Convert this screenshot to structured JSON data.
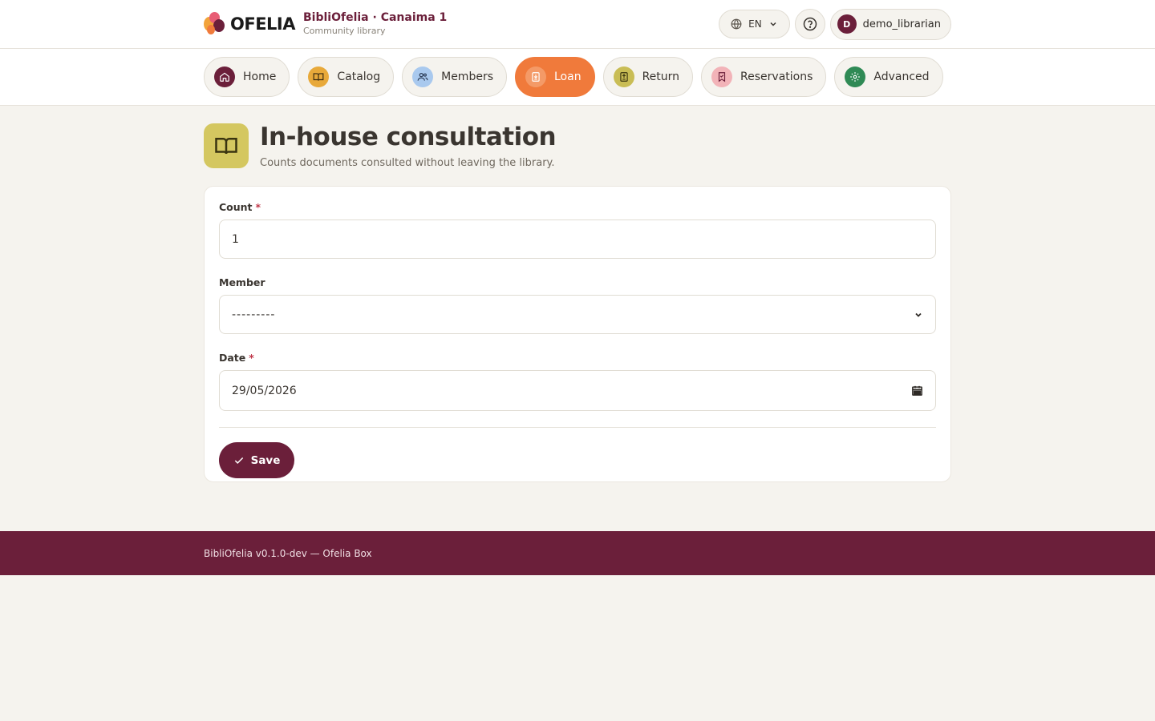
{
  "header": {
    "logo_word": "OFELIA",
    "brand_title": "BibliOfelia · Canaima 1",
    "brand_subtitle": "Community library",
    "language": "EN",
    "user_initial": "D",
    "username": "demo_librarian"
  },
  "nav": {
    "items": [
      {
        "label": "Home",
        "icon": "home-icon",
        "color": "#6b1f3a"
      },
      {
        "label": "Catalog",
        "icon": "book-icon",
        "color": "#e8a93a"
      },
      {
        "label": "Members",
        "icon": "users-icon",
        "color": "#a9c9ee"
      },
      {
        "label": "Loan",
        "icon": "loan-icon",
        "color": "#f07a3b",
        "active": true
      },
      {
        "label": "Return",
        "icon": "return-icon",
        "color": "#c9bd55"
      },
      {
        "label": "Reservations",
        "icon": "bookmark-icon",
        "color": "#f2b3b8"
      },
      {
        "label": "Advanced",
        "icon": "gear-icon",
        "color": "#2f8a55"
      }
    ]
  },
  "page": {
    "title": "In-house consultation",
    "subtitle": "Counts documents consulted without leaving the library."
  },
  "form": {
    "count_label": "Count",
    "count_value": "1",
    "member_label": "Member",
    "member_value": "---------",
    "date_label": "Date",
    "date_value": "29/05/2026",
    "required_mark": "*",
    "save_label": "Save"
  },
  "footer": {
    "text": "BibliOfelia v0.1.0-dev — Ofelia Box"
  },
  "colors": {
    "brand": "#6b1f3a",
    "accent": "#f07a3b",
    "background": "#f5f3ee"
  }
}
